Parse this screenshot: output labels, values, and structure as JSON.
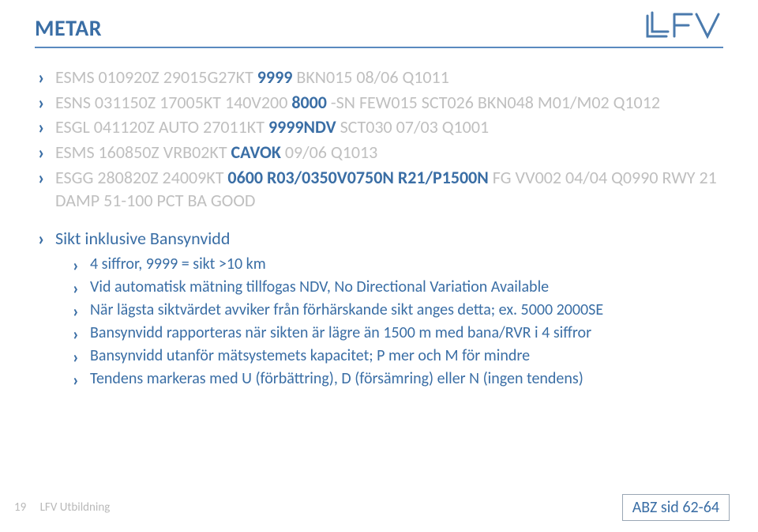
{
  "title": "METAR",
  "metar": {
    "l1": {
      "g1": "ESMS 010920Z 29015G27KT ",
      "b1": "9999",
      "g2": " BKN015 08/06 Q1011"
    },
    "l2": {
      "g1": "ESNS 031150Z 17005KT 140V200 ",
      "b1": "8000",
      "g2": " -SN FEW015 SCT026 BKN048 M01/M02 Q1012"
    },
    "l3": {
      "g1": "ESGL 041120Z AUTO 27011KT ",
      "b1": "9999NDV",
      "g2": " SCT030 07/03 Q1001"
    },
    "l4": {
      "g1": "ESMS 160850Z VRB02KT ",
      "b1": "CAVOK",
      "g2": " 09/06 Q1013"
    },
    "l5": {
      "g1": "ESGG 280820Z 24009KT ",
      "b1": "0600 R03/0350V0750N R21/P1500N",
      "g2": " FG VV002 04/04 Q0990 RWY 21 DAMP 51-100 PCT BA GOOD"
    }
  },
  "section_head": "Sikt inklusive Bansynvidd",
  "subitems": [
    "4 siffror, 9999 = sikt >10 km",
    "Vid automatisk mätning tillfogas NDV, No Directional Variation Available",
    "När lägsta siktvärdet avviker från förhärskande sikt anges detta; ex. 5000 2000SE",
    "Bansynvidd rapporteras när sikten är lägre än 1500 m med bana/RVR i 4 siffror",
    "Bansynvidd utanför mätsystemets kapacitet; P mer och M för mindre",
    "Tendens markeras med U (förbättring), D (försämring) eller N (ingen tendens)"
  ],
  "footer": {
    "page": "19",
    "org": "LFV Utbildning",
    "badge": "ABZ sid 62-64"
  },
  "logo_text": "LFV"
}
